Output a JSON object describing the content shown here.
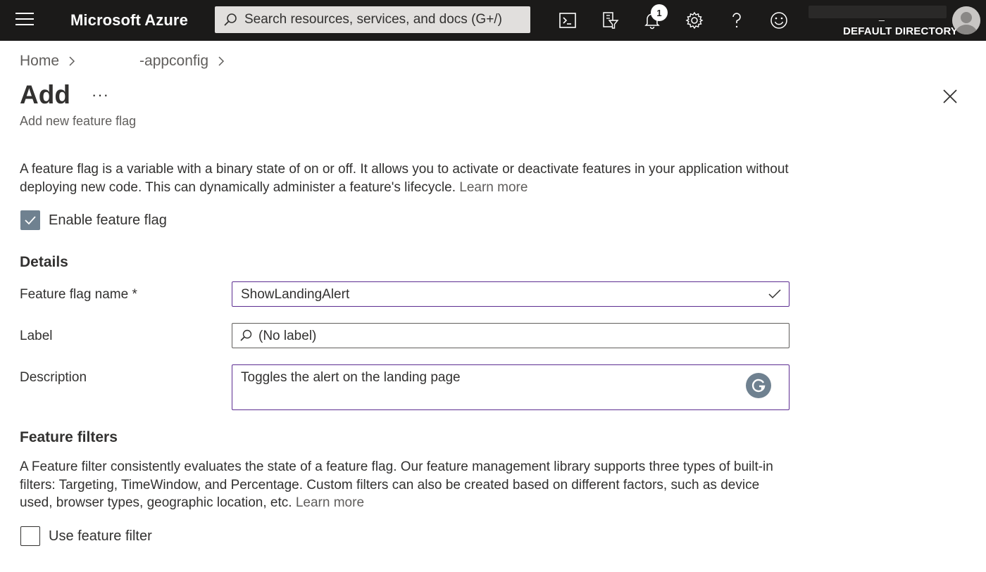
{
  "topbar": {
    "brand": "Microsoft Azure",
    "search_placeholder": "Search resources, services, and docs (G+/)",
    "notification_count": "1",
    "directory_dash": "_",
    "directory": "DEFAULT DIRECTORY",
    "icons": [
      "menu-icon",
      "cloud-shell-icon",
      "directory-filter-icon",
      "notification-icon",
      "settings-icon",
      "help-icon",
      "feedback-icon",
      "avatar"
    ]
  },
  "breadcrumb": {
    "home": "Home",
    "resource": "-appconfig"
  },
  "header": {
    "title": "Add",
    "more": "···",
    "subtitle": "Add new feature flag"
  },
  "intro": {
    "text": "A feature flag is a variable with a binary state of on or off. It allows you to activate or deactivate features in your application without deploying new code. This can dynamically administer a feature's lifecycle.",
    "learn_more": "Learn more"
  },
  "enable_flag": {
    "label": "Enable feature flag",
    "checked": true
  },
  "details": {
    "title": "Details",
    "name_label": "Feature flag name *",
    "name_value": "ShowLandingAlert",
    "label_label": "Label",
    "label_placeholder": "(No label)",
    "description_label": "Description",
    "description_value": "Toggles the alert on the landing page"
  },
  "filters": {
    "title": "Feature filters",
    "text": "A Feature filter consistently evaluates the state of a feature flag. Our feature management library supports three types of built-in filters: Targeting, TimeWindow, and Percentage. Custom filters can also be created based on different factors, such as device used, browser types, geographic location, etc.",
    "learn_more": "Learn more",
    "use_filter_label": "Use feature filter",
    "use_filter_checked": false
  },
  "colors": {
    "topbar_bg": "#1b1a19",
    "focus_border": "#5c2d91",
    "checkbox_fill": "#6f8190",
    "link": "#605e5c"
  }
}
